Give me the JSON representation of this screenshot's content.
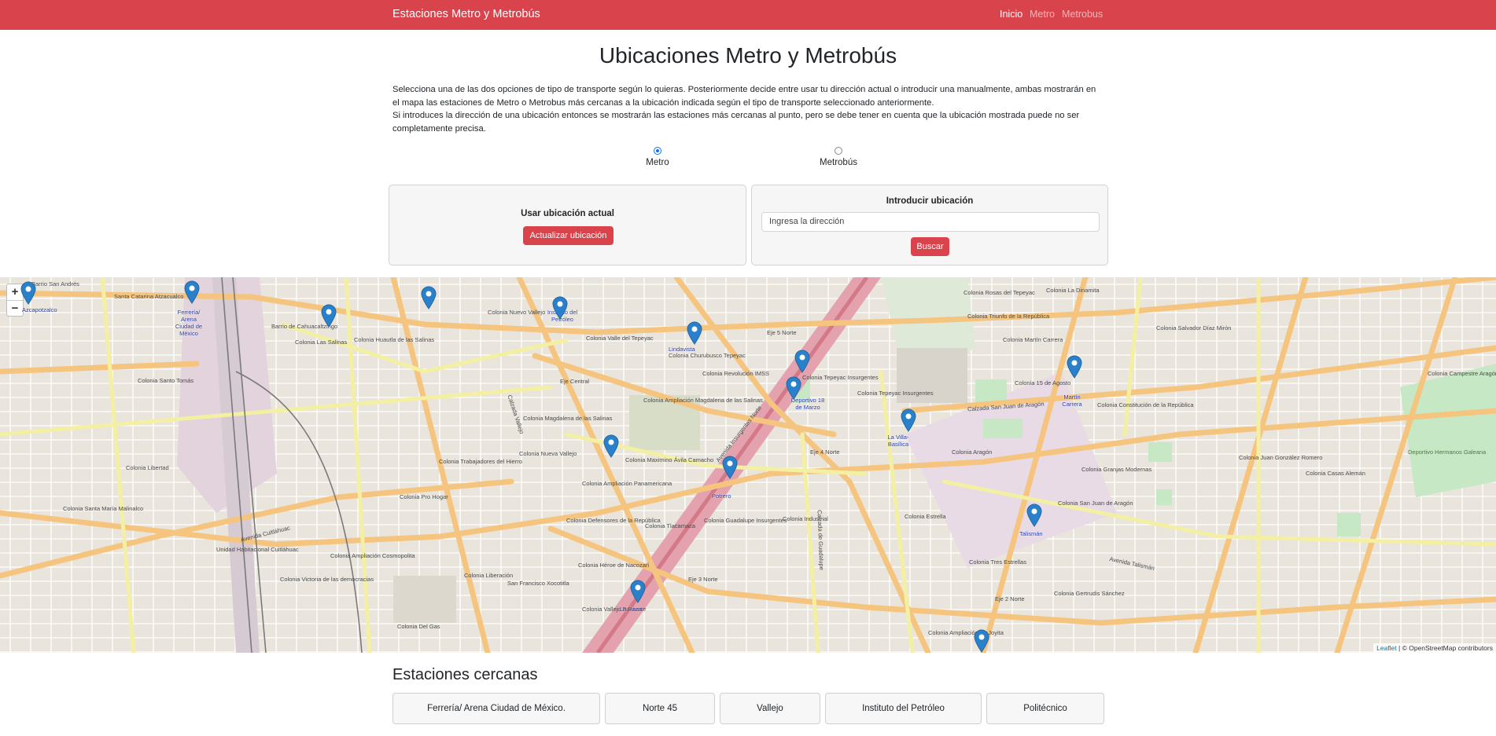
{
  "navbar": {
    "brand": "Estaciones Metro y Metrobús",
    "links": [
      "Inicio",
      "Metro",
      "Metrobus"
    ]
  },
  "header": {
    "title": "Ubicaciones Metro y Metrobús",
    "intro_1": "Selecciona una de las dos opciones de tipo de transporte según lo quieras. Posteriormente decide entre usar tu dirección actual o introducir una manualmente, ambas mostrarán en el mapa las estaciones de Metro o Metrobus más cercanas a la ubicación indicada según el tipo de transporte seleccionado anteriormente.",
    "intro_2": "Si introduces la dirección de una ubicación entonces se mostrarán las estaciones más cercanas al punto, pero se debe tener en cuenta que la ubicación mostrada puede no ser completamente precisa."
  },
  "transport": {
    "options": [
      "Metro",
      "Metrobús"
    ],
    "selected": "Metro"
  },
  "current_location": {
    "title": "Usar ubicación actual",
    "button": "Actualizar ubicación"
  },
  "manual_location": {
    "title": "Introducir ubicación",
    "placeholder": "Ingresa la dirección",
    "button": "Buscar"
  },
  "map": {
    "zoom_in": "+",
    "zoom_out": "−",
    "attribution_leaflet": "Leaflet",
    "attribution_rest": "| © OpenStreetMap contributors",
    "stations": [
      "Azcapotzalco",
      "Ferrería/ Arena Ciudad de México",
      "Instituto del Petróleo",
      "Lindavista",
      "Deportivo 18 de Marzo",
      "La Villa-Basílica",
      "Martín Carrera",
      "Potrero",
      "La Raza",
      "Talismán"
    ],
    "street_labels": [
      "Barrio San Andrés",
      "Santa Catarina Atzacualco",
      "Barrio de Cahuacaltzingo",
      "Colonia Las Salinas",
      "Colonia Huautla de las Salinas",
      "Colonia Nuevo Vallejo",
      "Colonia Valle del Tepeyac",
      "Colonia Churubusco Tepeyac",
      "Colonia Revolución IMSS",
      "Colonia Ampliación Magdalena de las Salinas",
      "Colonia Magdalena de las Salinas",
      "Colonia Tepeyac Insurgentes",
      "Colonia Estrella",
      "Colonia Industrial",
      "Colonia Guadalupe Insurgentes",
      "Colonia Maximino Ávila Camacho",
      "Colonia Ampliación Panamericana",
      "Colonia Defensores de la República",
      "Colonia Tlacamaca",
      "Colonia Héroe de Nacozari",
      "Colonia Vallejo Poniente",
      "Colonia Liberación",
      "Colonia Del Gas",
      "San Francisco Xocotitla",
      "Colonia Aragón",
      "Colonia Granjas Modernas",
      "Colonia San Juan de Aragón",
      "Colonia Gertrudis Sánchez",
      "Colonia Casas Alemán",
      "Colonia Campestre Aragón",
      "Deportivo Hermanos Galeana",
      "Colonia Tres Estrellas",
      "Colonia Ampliación La Joyita",
      "Colonia Nueva Vallejo",
      "Colonia Pro Hogar",
      "Colonia Trabajadores del Hierro",
      "Colonia Victoria de las democracias",
      "Unidad Habitacional Cuitláhuac",
      "Colonia Santo Tomás",
      "Colonia Libertad",
      "Colonia Santa María Malinalco",
      "Colonia Ampliación Cosmopolita",
      "Avenida Cuitláhuac",
      "Calzada Vallejo",
      "Avenida Insurgentes Norte",
      "Calzada de Guadalupe",
      "Calzada San Juan de Aragón",
      "Avenida Talismán",
      "Eje Central",
      "Eje 5 Norte",
      "Eje 4 Norte",
      "Eje 3 Norte",
      "Eje 2 Norte",
      "Colonia Tepeyac Insurgentes",
      "Colonia 15 de Agosto",
      "Colonia Constitución de la República",
      "Colonia Salvador Díaz Mirón",
      "Colonia Martín Carrera",
      "Colonia Triunfo de la República",
      "Colonia Rosas del Tepeyac",
      "Colonia La Dinamita",
      "Colonia Juan González Romero"
    ]
  },
  "nearby": {
    "title": "Estaciones cercanas",
    "stations": [
      "Ferrería/ Arena Ciudad de México.",
      "Norte 45",
      "Vallejo",
      "Instituto del Petróleo",
      "Politécnico"
    ]
  },
  "colors": {
    "navbar": "#d9434b",
    "button": "#d9434b",
    "marker": "#2a81cb",
    "map_background": "#ebe7df",
    "major_road": "#f7c98a",
    "secondary_road": "#f6f4a7",
    "rail_area": "#e2c8cd",
    "park": "#c7e8c4"
  }
}
